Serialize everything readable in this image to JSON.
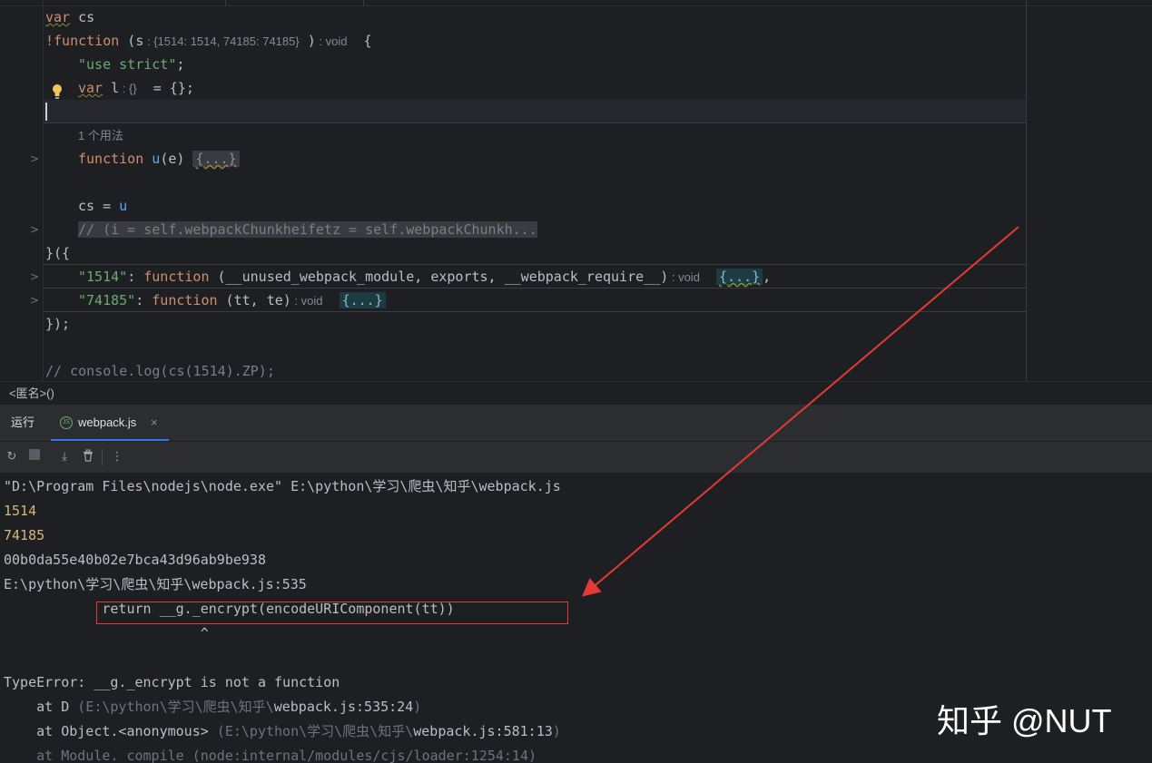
{
  "editor": {
    "line1": {
      "kw": "var",
      "name": " cs"
    },
    "line2": {
      "bang": "!",
      "kw": "function",
      "open": " (s",
      "hint": " : {1514: 1514, 74185: 74185}",
      "close": " )",
      "ret": " : void",
      "brace": "  {"
    },
    "line3": {
      "str": "\"use strict\"",
      "semi": ";"
    },
    "line4": {
      "kw": "var",
      "name": " l",
      "hint": " : {}",
      "rest": "  = {};"
    },
    "usage": "1 个用法",
    "line6": {
      "kw": "function",
      "name": " u",
      "args": "(e) ",
      "fold": "{...}"
    },
    "line7": {
      "text": "cs = ",
      "ref": "u"
    },
    "line8": {
      "comment": "// (i = self.webpackChunkheifetz = self.webpackChunkh..."
    },
    "line9": {
      "text": "}({"
    },
    "line10": {
      "key": "\"1514\"",
      "colon": ": ",
      "kw": "function",
      "args": " (__unused_webpack_module, exports, __webpack_require__)",
      "ret": " : void",
      "fold": "{...}",
      "tail": ","
    },
    "line11": {
      "key": "\"74185\"",
      "colon": ": ",
      "kw": "function",
      "args": " (tt, te)",
      "ret": " : void",
      "fold": "{...}"
    },
    "line12": {
      "text": "});"
    },
    "line14": {
      "comment": "// console.log(cs(1514).ZP);"
    }
  },
  "breadcrumb": "<匿名>()",
  "run_panel": {
    "title": "运行",
    "tab_label": "webpack.js",
    "tab_icon_text": "JS",
    "close_glyph": "×"
  },
  "console": {
    "cmd": "\"D:\\Program Files\\nodejs\\node.exe\" E:\\python\\学习\\爬虫\\知乎\\webpack.js",
    "out1": "1514",
    "out2": "74185",
    "out3": "00b0da55e40b02e7bca43d96ab9be938",
    "err_loc": "E:\\python\\学习\\爬虫\\知乎\\webpack.js:535",
    "err_code": "            return __g._encrypt(encodeURIComponent(tt))",
    "err_caret": "                        ^",
    "err_msg": "TypeError: __g._encrypt is not a function",
    "stack1_at": "    at D ",
    "stack1_dim": "(E:\\python\\学习\\爬虫\\知乎\\",
    "stack1_file": "webpack.js:535:24",
    "stack1_end": ")",
    "stack2_at": "    at Object.<anonymous> ",
    "stack2_dim": "(E:\\python\\学习\\爬虫\\知乎\\",
    "stack2_file": "webpack.js:581:13",
    "stack2_end": ")",
    "stack3": "    at Module._compile (node:internal/modules/cjs/loader:1254:14)"
  },
  "watermark": "知乎 @NUT",
  "colors": {
    "keyword": "#cf8e6d",
    "string": "#6aab73",
    "function": "#56a8f5",
    "output": "#d5b778",
    "annotation": "#e53935"
  }
}
